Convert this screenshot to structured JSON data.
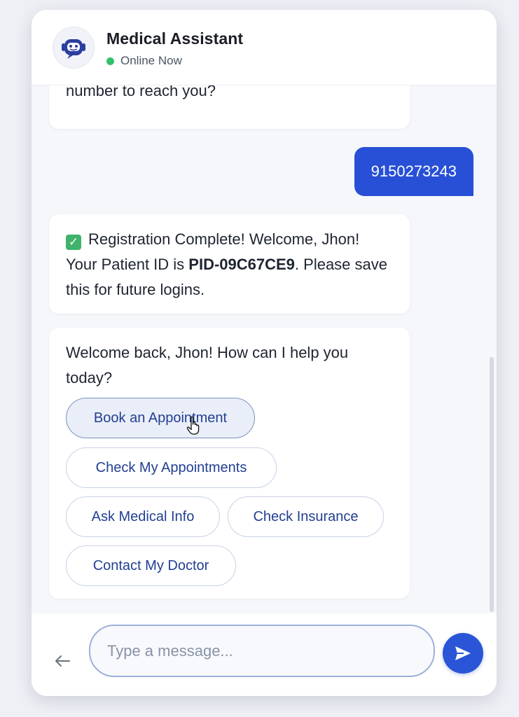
{
  "header": {
    "title": "Medical Assistant",
    "status": "Online Now",
    "status_color": "#35c06a",
    "avatar_icon": "robot-icon"
  },
  "messages": {
    "bot_1": "number to reach you?",
    "user_1": "9150273243",
    "bot_2": {
      "emoji": "✓",
      "text_before": "Registration Complete! Welcome, Jhon! Your Patient ID is ",
      "patient_id": "PID-09C67CE9",
      "text_after": ". Please save this for future logins."
    },
    "bot_3": {
      "text": "Welcome back, Jhon! How can I help you today?",
      "options": [
        "Book an Appointment",
        "Check My Appointments",
        "Ask Medical Info",
        "Check Insurance",
        "Contact My Doctor"
      ]
    }
  },
  "composer": {
    "placeholder": "Type a message...",
    "value": ""
  },
  "colors": {
    "accent": "#2850d6",
    "chip_text": "#223f92"
  }
}
